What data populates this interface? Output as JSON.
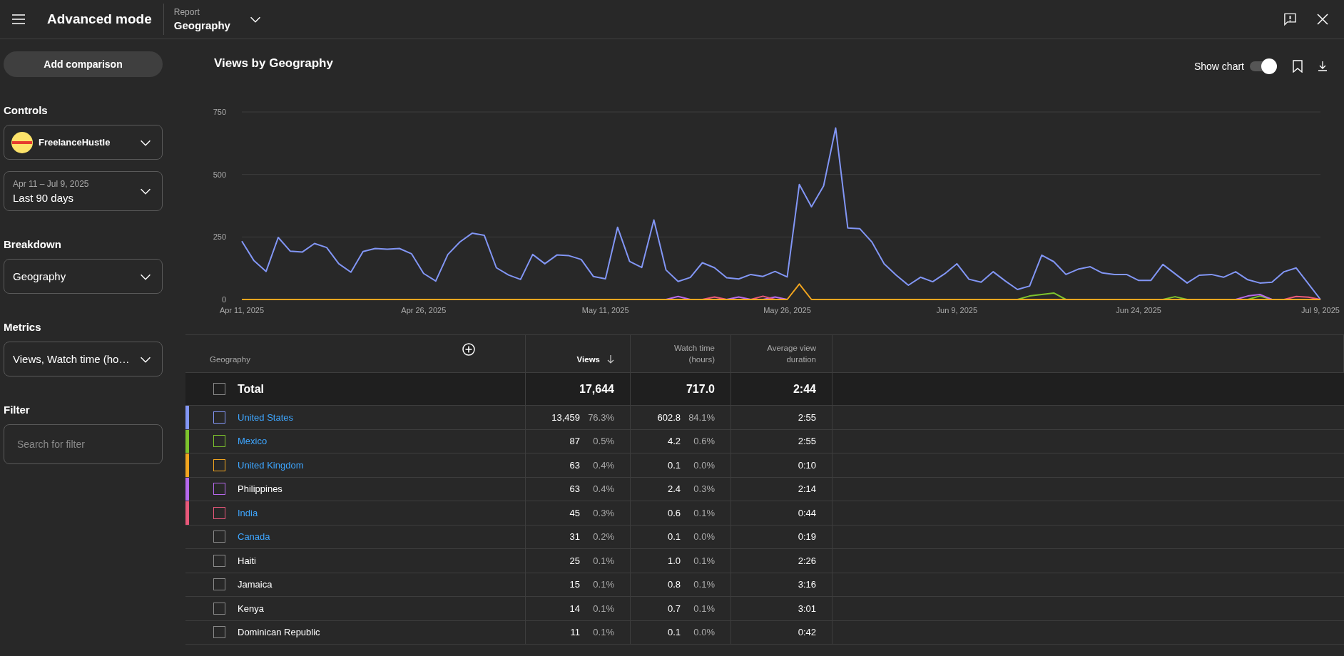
{
  "top_bar": {
    "title": "Advanced mode",
    "report_label": "Report",
    "report_value": "Geography"
  },
  "sidebar": {
    "add_comparison": "Add comparison",
    "sections": [
      {
        "heading": "Controls",
        "fields": [
          {
            "kind": "channel",
            "value": "FreelanceHustle"
          },
          {
            "kind": "date",
            "caption": "Apr 11 – Jul 9, 2025",
            "value": "Last 90 days"
          }
        ]
      },
      {
        "heading": "Breakdown",
        "fields": [
          {
            "kind": "select",
            "value": "Geography"
          }
        ]
      },
      {
        "heading": "Metrics",
        "fields": [
          {
            "kind": "select",
            "value": "Views, Watch time (ho…"
          }
        ]
      },
      {
        "heading": "Filter",
        "fields": [
          {
            "kind": "search",
            "placeholder": "Search for filter"
          }
        ]
      }
    ]
  },
  "chart_panel": {
    "title": "Views by Geography",
    "show_chart": {
      "label": "Show chart",
      "on": true
    },
    "chart_data": {
      "type": "line",
      "categories": [
        "Apr 11, 2025",
        null,
        null,
        null,
        null,
        null,
        null,
        null,
        null,
        null,
        null,
        null,
        null,
        null,
        null,
        "Apr 26, 2025",
        null,
        null,
        null,
        null,
        null,
        null,
        null,
        null,
        null,
        null,
        null,
        null,
        null,
        null,
        "May 11, 2025",
        null,
        null,
        null,
        null,
        null,
        null,
        null,
        null,
        null,
        null,
        null,
        null,
        null,
        null,
        "May 26, 2025",
        null,
        null,
        null,
        null,
        null,
        null,
        null,
        null,
        null,
        null,
        null,
        null,
        null,
        "Jun 9, 2025",
        null,
        null,
        null,
        null,
        null,
        null,
        null,
        null,
        null,
        null,
        null,
        null,
        null,
        null,
        "Jun 24, 2025",
        null,
        null,
        null,
        null,
        null,
        null,
        null,
        null,
        null,
        null,
        null,
        null,
        null,
        null,
        "Jul 9, 2025"
      ],
      "ylim": [
        0,
        750
      ],
      "yticks": [
        0,
        250,
        500,
        750
      ],
      "series": [
        {
          "color": "#8296f5",
          "values": [
            233,
            155,
            112,
            248,
            193,
            190,
            224,
            208,
            143,
            109,
            192,
            204,
            201,
            204,
            183,
            104,
            74,
            180,
            230,
            265,
            257,
            127,
            98,
            80,
            180,
            143,
            178,
            175,
            160,
            92,
            83,
            289,
            152,
            128,
            318,
            118,
            72,
            88,
            147,
            127,
            87,
            82,
            100,
            92,
            112,
            90,
            460,
            371,
            454,
            686,
            286,
            283,
            229,
            143,
            97,
            57,
            89,
            71,
            103,
            143,
            81,
            69,
            111,
            74,
            40,
            54,
            177,
            151,
            100,
            121,
            131,
            106,
            100,
            100,
            76,
            76,
            140,
            103,
            66,
            97,
            100,
            89,
            111,
            79,
            66,
            69,
            111,
            126,
            63,
            0
          ]
        },
        {
          "color": "#7dc42d",
          "values": [
            null,
            null,
            null,
            null,
            null,
            null,
            null,
            null,
            null,
            null,
            null,
            null,
            null,
            null,
            null,
            null,
            null,
            null,
            null,
            null,
            null,
            null,
            null,
            null,
            null,
            null,
            null,
            null,
            null,
            null,
            null,
            null,
            null,
            null,
            null,
            null,
            null,
            null,
            null,
            null,
            null,
            null,
            null,
            null,
            null,
            null,
            null,
            null,
            null,
            null,
            null,
            null,
            null,
            null,
            null,
            null,
            null,
            null,
            null,
            null,
            null,
            null,
            null,
            null,
            0,
            14,
            20,
            26,
            0,
            null,
            null,
            null,
            null,
            null,
            null,
            null,
            0,
            11,
            0,
            null,
            null,
            null,
            null,
            0,
            14,
            0,
            null,
            null,
            null,
            null
          ]
        },
        {
          "color": "#b668ec",
          "values": [
            null,
            null,
            null,
            null,
            null,
            null,
            null,
            null,
            null,
            null,
            null,
            null,
            null,
            null,
            null,
            null,
            null,
            null,
            null,
            null,
            null,
            null,
            null,
            null,
            null,
            null,
            null,
            null,
            null,
            null,
            null,
            null,
            null,
            null,
            null,
            0,
            12,
            0,
            null,
            null,
            0,
            10,
            0,
            0,
            10,
            0,
            null,
            null,
            null,
            null,
            null,
            null,
            null,
            null,
            null,
            null,
            null,
            null,
            null,
            null,
            null,
            null,
            null,
            null,
            null,
            null,
            null,
            null,
            null,
            null,
            null,
            null,
            null,
            null,
            null,
            null,
            null,
            null,
            null,
            null,
            null,
            null,
            0,
            14,
            20,
            0,
            null,
            null,
            null,
            null
          ]
        },
        {
          "color": "#e8587a",
          "values": [
            null,
            null,
            null,
            null,
            null,
            null,
            null,
            null,
            null,
            null,
            null,
            null,
            null,
            null,
            null,
            null,
            null,
            null,
            null,
            null,
            null,
            null,
            null,
            null,
            null,
            null,
            null,
            null,
            null,
            null,
            null,
            null,
            null,
            null,
            null,
            null,
            null,
            null,
            0,
            10,
            0,
            null,
            0,
            13,
            0,
            null,
            null,
            null,
            null,
            null,
            null,
            null,
            null,
            null,
            null,
            null,
            null,
            null,
            null,
            null,
            null,
            null,
            null,
            null,
            null,
            null,
            null,
            null,
            null,
            null,
            null,
            null,
            null,
            null,
            null,
            null,
            null,
            null,
            null,
            null,
            null,
            null,
            null,
            null,
            null,
            null,
            0,
            12,
            9,
            0
          ]
        },
        {
          "color": "#f2a51f",
          "values": [
            0,
            0,
            0,
            0,
            0,
            0,
            0,
            0,
            0,
            0,
            0,
            0,
            0,
            0,
            0,
            0,
            0,
            0,
            0,
            0,
            0,
            0,
            0,
            0,
            0,
            0,
            0,
            0,
            0,
            0,
            0,
            0,
            0,
            0,
            0,
            0,
            0,
            0,
            0,
            0,
            0,
            0,
            0,
            0,
            0,
            0,
            62,
            0,
            0,
            0,
            0,
            0,
            0,
            0,
            0,
            0,
            0,
            0,
            0,
            0,
            0,
            0,
            0,
            0,
            0,
            0,
            0,
            0,
            0,
            0,
            0,
            0,
            0,
            0,
            0,
            0,
            0,
            0,
            0,
            0,
            0,
            0,
            0,
            0,
            0,
            0,
            0,
            0,
            0,
            0
          ]
        }
      ]
    }
  },
  "table": {
    "columns": [
      {
        "label": "Geography",
        "sorted": false
      },
      {
        "label": "Views",
        "sorted": true
      },
      {
        "label": "Watch time (hours)",
        "sorted": false
      },
      {
        "label": "Average view duration",
        "sorted": false
      }
    ],
    "total": {
      "label": "Total",
      "checked": false,
      "views": "17,644",
      "watch": "717.0",
      "avg": "2:44"
    },
    "rows": [
      {
        "name": "United States",
        "checked": false,
        "link": true,
        "color": "#8296f5",
        "views": "13,459",
        "views_pct": "76.3%",
        "watch": "602.8",
        "watch_pct": "84.1%",
        "avg": "2:55"
      },
      {
        "name": "Mexico",
        "checked": false,
        "link": true,
        "color": "#7dc42d",
        "views": "87",
        "views_pct": "0.5%",
        "watch": "4.2",
        "watch_pct": "0.6%",
        "avg": "2:55"
      },
      {
        "name": "United Kingdom",
        "checked": false,
        "link": true,
        "color": "#f2a51f",
        "views": "63",
        "views_pct": "0.4%",
        "watch": "0.1",
        "watch_pct": "0.0%",
        "avg": "0:10"
      },
      {
        "name": "Philippines",
        "checked": false,
        "link": false,
        "color": "#b668ec",
        "views": "63",
        "views_pct": "0.4%",
        "watch": "2.4",
        "watch_pct": "0.3%",
        "avg": "2:14"
      },
      {
        "name": "India",
        "checked": false,
        "link": true,
        "color": "#e8587a",
        "views": "45",
        "views_pct": "0.3%",
        "watch": "0.6",
        "watch_pct": "0.1%",
        "avg": "0:44"
      },
      {
        "name": "Canada",
        "checked": false,
        "link": true,
        "views": "31",
        "views_pct": "0.2%",
        "watch": "0.1",
        "watch_pct": "0.0%",
        "avg": "0:19"
      },
      {
        "name": "Haiti",
        "checked": false,
        "link": false,
        "views": "25",
        "views_pct": "0.1%",
        "watch": "1.0",
        "watch_pct": "0.1%",
        "avg": "2:26"
      },
      {
        "name": "Jamaica",
        "checked": false,
        "link": false,
        "views": "15",
        "views_pct": "0.1%",
        "watch": "0.8",
        "watch_pct": "0.1%",
        "avg": "3:16"
      },
      {
        "name": "Kenya",
        "checked": false,
        "link": false,
        "views": "14",
        "views_pct": "0.1%",
        "watch": "0.7",
        "watch_pct": "0.1%",
        "avg": "3:01"
      },
      {
        "name": "Dominican Republic",
        "checked": false,
        "link": false,
        "views": "11",
        "views_pct": "0.1%",
        "watch": "0.1",
        "watch_pct": "0.0%",
        "avg": "0:42"
      }
    ]
  }
}
